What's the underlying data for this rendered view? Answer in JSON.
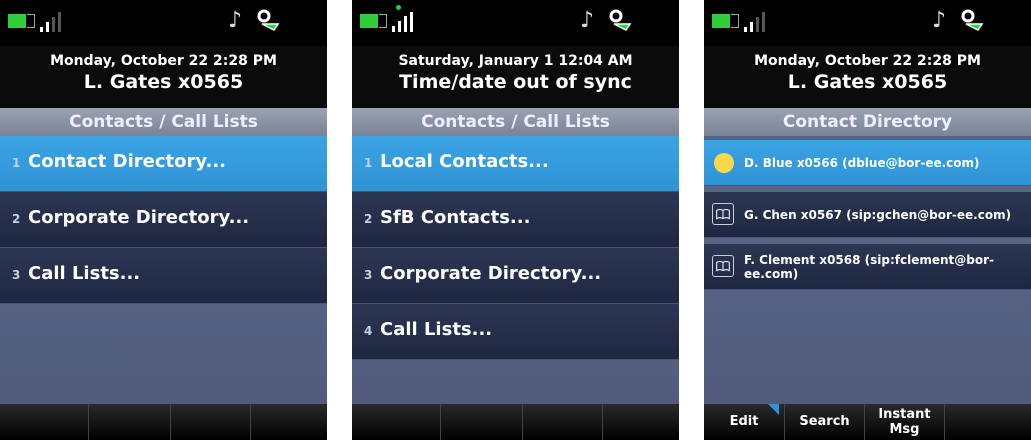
{
  "screens": [
    {
      "date": "Monday, October 22 2:28 PM",
      "line": "L. Gates x0565",
      "title": "Contacts / Call Lists",
      "items": [
        {
          "num": "1",
          "label": "Contact Directory..."
        },
        {
          "num": "2",
          "label": "Corporate Directory..."
        },
        {
          "num": "3",
          "label": "Call Lists..."
        }
      ]
    },
    {
      "date": "Saturday, January 1 12:04 AM",
      "line": "Time/date out of sync",
      "title": "Contacts / Call Lists",
      "items": [
        {
          "num": "1",
          "label": "Local Contacts..."
        },
        {
          "num": "2",
          "label": "SfB Contacts..."
        },
        {
          "num": "3",
          "label": "Corporate Directory..."
        },
        {
          "num": "4",
          "label": "Call Lists..."
        }
      ]
    },
    {
      "date": "Monday, October 22 2:28 PM",
      "line": "L. Gates x0565",
      "title": "Contact Directory",
      "contacts": [
        {
          "text": "D. Blue x0566 (dblue@bor-ee.com)"
        },
        {
          "text": "G. Chen x0567 (sip:gchen@bor-ee.com)"
        },
        {
          "text": "F. Clement x0568 (sip:fclement@bor-ee.com)"
        }
      ],
      "softkeys": {
        "edit": "Edit",
        "search": "Search",
        "instant_msg": "Instant Msg"
      }
    }
  ],
  "icons": {
    "battery": "battery-icon",
    "signal": "signal-bars-icon",
    "ringer": "music-note-icon",
    "link": "link-icon",
    "presence": "presence-icon",
    "book": "directory-book-icon"
  },
  "colors": {
    "selected": "#3aa4e4",
    "header": "#0b0b0b",
    "battery": "#2ecf3a",
    "presence": "#f6d84a"
  }
}
